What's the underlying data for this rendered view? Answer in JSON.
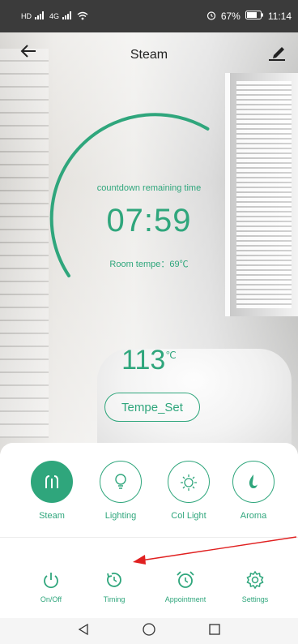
{
  "status_bar": {
    "battery": "67%",
    "time": "11:14",
    "net_left": "HD",
    "net2": "4G"
  },
  "header": {
    "title": "Steam"
  },
  "timer": {
    "label": "countdown remaining time",
    "value": "07:59",
    "room_temp": "Room tempe：69℃",
    "progress_fraction": 0.62
  },
  "temperature": {
    "value": "113",
    "unit": "℃"
  },
  "tempset_label": "Tempe_Set",
  "modes": [
    {
      "label": "Steam",
      "icon": "steam-icon",
      "active": true
    },
    {
      "label": "Lighting",
      "icon": "bulb-icon",
      "active": false
    },
    {
      "label": "Col Light",
      "icon": "sun-icon",
      "active": false
    },
    {
      "label": "Aroma",
      "icon": "flame-icon",
      "active": false
    }
  ],
  "functions": [
    {
      "label": "On/Off",
      "icon": "power-icon"
    },
    {
      "label": "Timing",
      "icon": "timer-icon"
    },
    {
      "label": "Appointment",
      "icon": "alarm-clock-icon"
    },
    {
      "label": "Settings",
      "icon": "gear-icon"
    }
  ],
  "colors": {
    "accent": "#2fa67c",
    "annotation_arrow": "#e02020"
  }
}
